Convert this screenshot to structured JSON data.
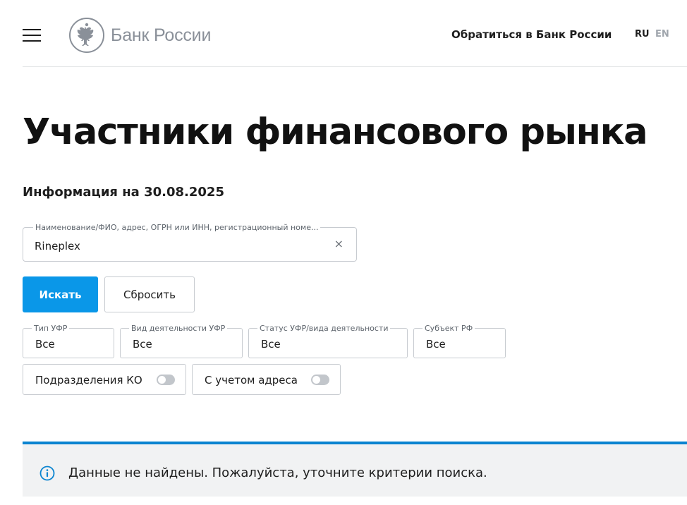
{
  "header": {
    "logo_text": "Банк России",
    "contact_link": "Обратиться в Банк России",
    "lang_ru": "RU",
    "lang_en": "EN"
  },
  "main": {
    "title": "Участники финансового рынка",
    "info_date": "Информация на 30.08.2025",
    "search": {
      "label": "Наименование/ФИО, адрес, ОГРН или ИНН, регистрационный номе...",
      "value": "Rineplex",
      "clear_symbol": "×"
    },
    "buttons": {
      "search_label": "Искать",
      "reset_label": "Сбросить"
    },
    "filters": [
      {
        "label": "Тип УФР",
        "value": "Все"
      },
      {
        "label": "Вид деятельности УФР",
        "value": "Все"
      },
      {
        "label": "Статус УФР/вида деятельности",
        "value": "Все"
      },
      {
        "label": "Субъект РФ",
        "value": "Все"
      }
    ],
    "toggles": [
      {
        "label": "Подразделения КО",
        "on": false
      },
      {
        "label": "С учетом адреса",
        "on": false
      }
    ],
    "info_message": "Данные не найдены. Пожалуйста, уточните критерии поиска."
  },
  "colors": {
    "primary_button": "#0a97e8",
    "notice_border": "#0a84d0",
    "notice_background": "#f1f2f3",
    "logo_gray": "#8a9099"
  },
  "icons": {
    "menu": "hamburger-icon",
    "logo": "double-headed-eagle-emblem",
    "clear": "close-icon",
    "info": "info-circle-icon"
  }
}
